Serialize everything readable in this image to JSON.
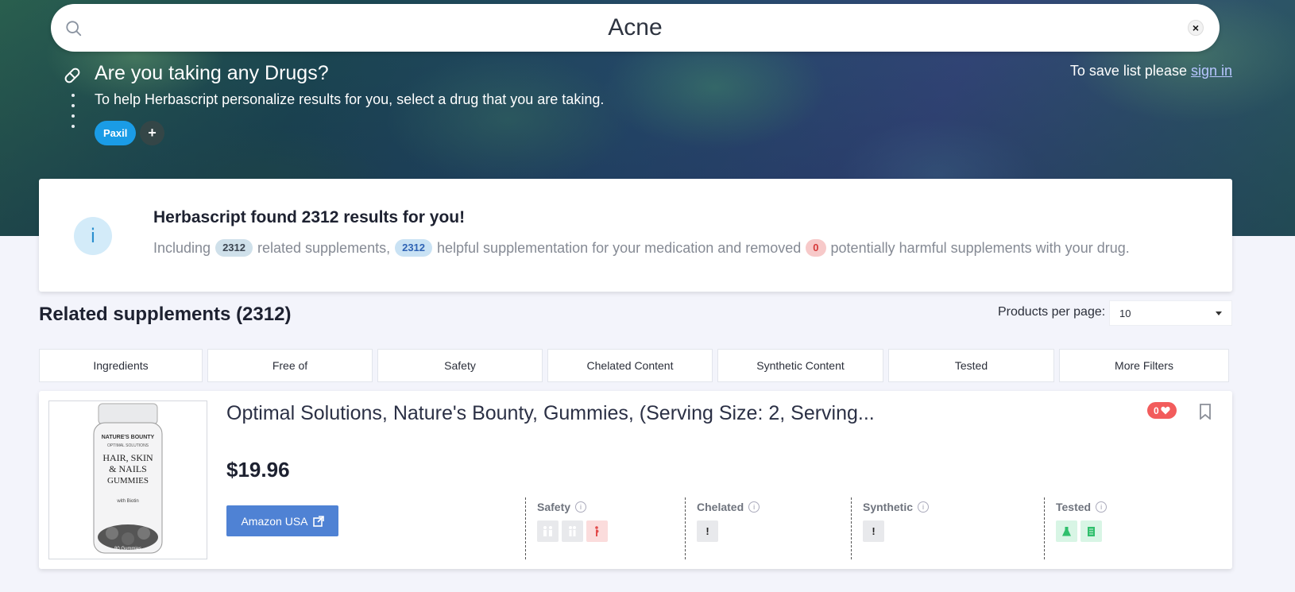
{
  "search": {
    "value": "Acne",
    "placeholder": ""
  },
  "drug_prompt": {
    "title": "Are you taking any Drugs?",
    "subtitle": "To help Herbascript personalize results for you, select a drug that you are taking.",
    "selected_drugs": [
      "Paxil"
    ],
    "add_label": "+"
  },
  "save_note": {
    "text": "To save list please ",
    "link": "sign in"
  },
  "info_card": {
    "icon": "i",
    "title": "Herbascript found 2312 results for you!",
    "part1": "Including",
    "count_related": "2312",
    "part2": "related supplements,",
    "count_helpful": "2312",
    "part3": "helpful supplementation for your medication and removed",
    "count_removed": "0",
    "part4": "potentially harmful supplements with your drug."
  },
  "related": {
    "title": "Related supplements (2312)",
    "per_page_label": "Products per page:",
    "per_page_value": "10"
  },
  "filters": [
    "Ingredients",
    "Free of",
    "Safety",
    "Chelated Content",
    "Synthetic Content",
    "Tested",
    "More Filters"
  ],
  "product": {
    "title": "Optimal Solutions, Nature's Bounty, Gummies, (Serving Size: 2, Serving...",
    "price": "$19.96",
    "store_button": "Amazon USA",
    "likes": "0",
    "attributes": {
      "safety": "Safety",
      "chelated": "Chelated",
      "synthetic": "Synthetic",
      "tested": "Tested"
    },
    "image_text": {
      "brand": "NATURE'S BOUNTY",
      "line": "OPTIMAL SOLUTIONS",
      "name1": "HAIR, SKIN",
      "name2": "& NAILS",
      "name3": "GUMMIES",
      "with": "with Biotin",
      "count": "80 Gummies"
    }
  },
  "colors": {
    "accent_blue": "#1a9ce6",
    "button_blue": "#4f82d4",
    "like_red": "#f25c5c"
  }
}
